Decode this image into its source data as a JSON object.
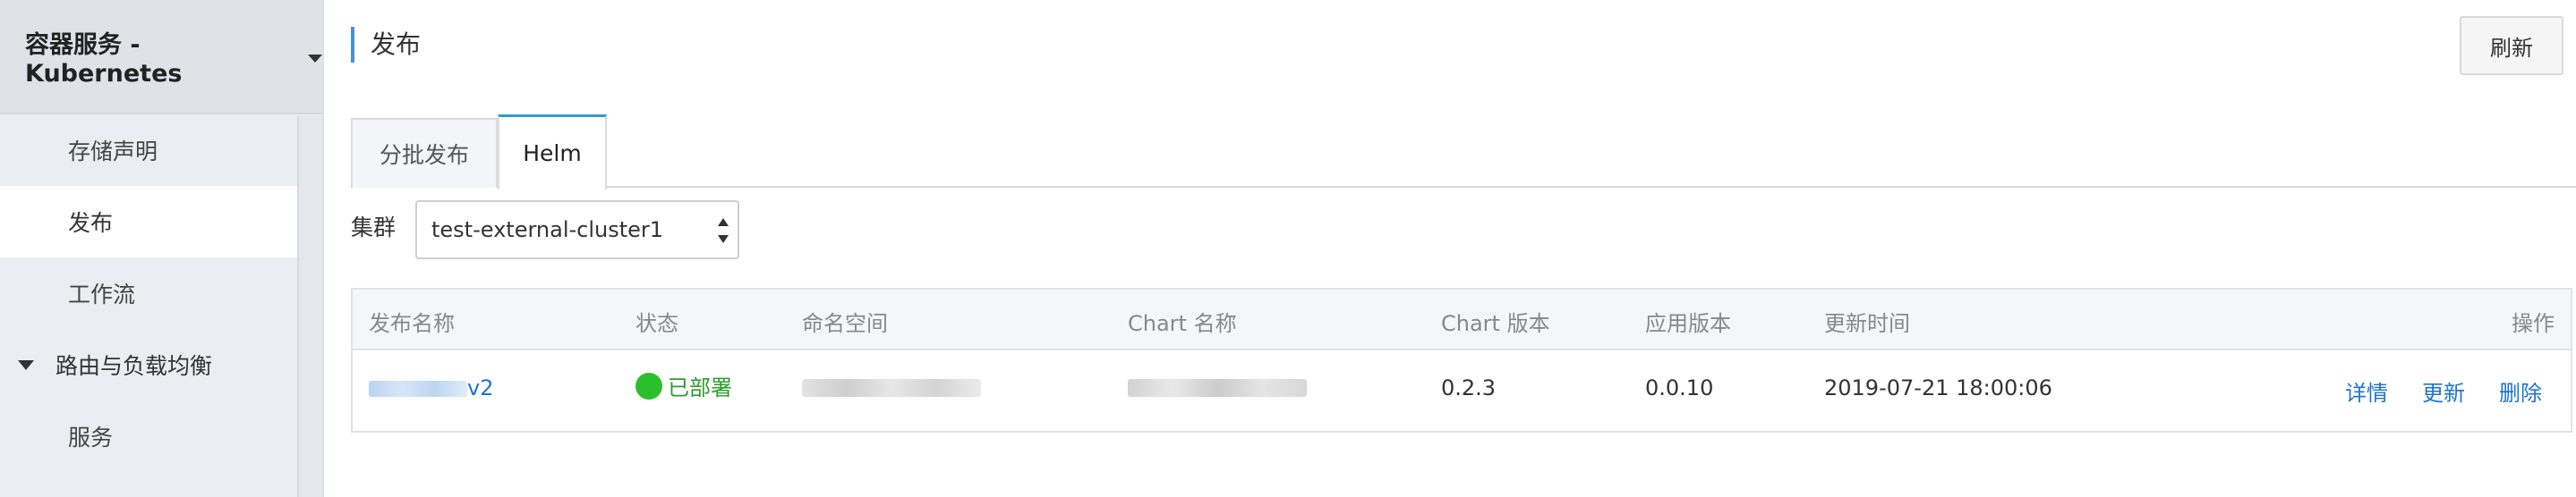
{
  "sidebar": {
    "title": "容器服务 - Kubernetes",
    "items": [
      {
        "label": "存储声明"
      },
      {
        "label": "发布"
      },
      {
        "label": "工作流"
      }
    ],
    "group": {
      "label": "路由与负载均衡"
    },
    "sub_items": [
      {
        "label": "服务"
      }
    ]
  },
  "page": {
    "title": "发布",
    "refresh_label": "刷新"
  },
  "tabs": [
    {
      "label": "分批发布"
    },
    {
      "label": "Helm"
    }
  ],
  "cluster": {
    "label": "集群",
    "selected": "test-external-cluster1"
  },
  "table": {
    "headers": [
      "发布名称",
      "状态",
      "命名空间",
      "Chart 名称",
      "Chart 版本",
      "应用版本",
      "更新时间",
      "操作"
    ],
    "rows": [
      {
        "name_suffix": "v2",
        "status": "已部署",
        "chart_version": "0.2.3",
        "app_version": "0.0.10",
        "updated": "2019-07-21 18:00:06",
        "actions": [
          "详情",
          "更新",
          "删除"
        ]
      }
    ]
  },
  "colors": {
    "accent": "#2d9bd6",
    "link": "#1e74d0",
    "status_ok": "#2bbf2b",
    "sidebar_bg": "#eaedf1"
  }
}
